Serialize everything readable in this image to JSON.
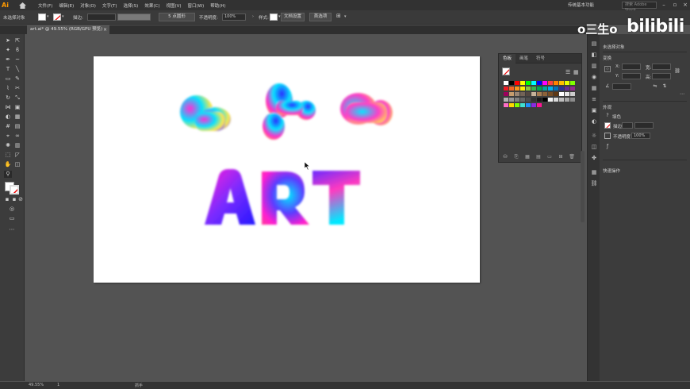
{
  "app": {
    "logo": "Ai",
    "menus": [
      "文件(F)",
      "编辑(E)",
      "对象(O)",
      "文字(T)",
      "选择(S)",
      "效果(C)",
      "视图(V)",
      "窗口(W)",
      "帮助(H)"
    ],
    "layout_name": "传统基本功能",
    "stock_search_placeholder": "搜索 Adobe Stock"
  },
  "control_bar": {
    "selection_label": "未选择对象",
    "stroke_label": "描边:",
    "brush_value": "5 点圆形",
    "opacity_label": "不透明度:",
    "opacity_value": "100%",
    "style_label": "样式:",
    "doc_setup_button": "文档设置",
    "preferences_button": "首选项"
  },
  "document_tab": {
    "title": "art.ai* @ 49.55% (RGB/GPU 预览)",
    "close": "×"
  },
  "swatches_panel": {
    "tabs": [
      "色板",
      "画笔",
      "符号"
    ],
    "colors_row1": [
      "#ffffff",
      "#000000",
      "#ff0000",
      "#ffff00",
      "#00ff00",
      "#00ffff",
      "#0000ff",
      "#ff00ff",
      "#ff4040",
      "#ff8000",
      "#ffc000",
      "#e6ff00",
      "#80ff00"
    ],
    "colors_row2": [
      "#ed1c24",
      "#f26522",
      "#f7941d",
      "#fff200",
      "#8dc63f",
      "#39b54a",
      "#00a651",
      "#00a99d",
      "#00aeef",
      "#0072bc",
      "#2e3192",
      "#662d91",
      "#92278f"
    ],
    "colors_row3": [
      "#9e005d",
      "#c69c6d",
      "#998675",
      "#736357",
      "#534741",
      "#c7b299",
      "#a67c52",
      "#8c6239",
      "#754c24",
      "#603813",
      "#ffffff",
      "#e6e6e6",
      "#cccccc"
    ],
    "colors_row4": [
      "#b3b3b3",
      "#999999",
      "#808080",
      "#666666",
      "#4d4d4d",
      "#333333",
      "#1a1a1a",
      "#000000",
      "#f2f2f2",
      "#d9d9d9",
      "#bfbfbf",
      "#a6a6a6",
      "#8c8c8c"
    ],
    "colors_row5": [
      "#ff6ec7",
      "#ffd700",
      "#7fff00",
      "#40e0d0",
      "#1e90ff",
      "#8a2be2",
      "#ff1493"
    ]
  },
  "properties_panel": {
    "header": "未选择对象",
    "transform_title": "变换",
    "x_label": "X:",
    "y_label": "Y:",
    "w_label": "宽:",
    "h_label": "高:",
    "appearance_title": "外观",
    "fill_label": "填色",
    "stroke_label": "描边",
    "opacity_label": "不透明度",
    "opacity_value": "100%",
    "quick_actions_title": "快速操作"
  },
  "watermark": {
    "channel": "o三生o",
    "brand": "bilibili"
  },
  "status_bar": {
    "zoom": "49.55%",
    "page": "1",
    "tool_status": "抓手"
  },
  "artwork": {
    "text": "ART",
    "gradient_colors": [
      "#ff00ff",
      "#00e5ff",
      "#ffe600",
      "#3d00ff",
      "#ff3ca0"
    ]
  }
}
